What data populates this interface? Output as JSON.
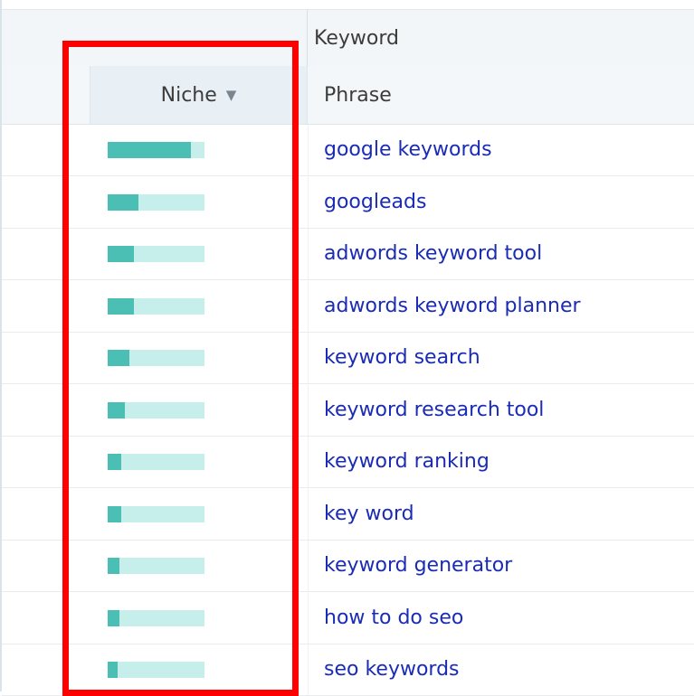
{
  "header": {
    "group_label": "Keyword",
    "niche_label": "Niche",
    "sort_arrow": "▼",
    "phrase_label": "Phrase"
  },
  "colors": {
    "bar_fill": "#4cbfb5",
    "bar_track": "#c6eeea",
    "link": "#1a2bb5",
    "highlight": "#ff0000"
  },
  "rows": [
    {
      "phrase": "google keywords",
      "niche": 0.86
    },
    {
      "phrase": "googleads",
      "niche": 0.32
    },
    {
      "phrase": "adwords keyword tool",
      "niche": 0.27
    },
    {
      "phrase": "adwords keyword planner",
      "niche": 0.27
    },
    {
      "phrase": "keyword search",
      "niche": 0.22
    },
    {
      "phrase": "keyword research tool",
      "niche": 0.18
    },
    {
      "phrase": "keyword ranking",
      "niche": 0.14
    },
    {
      "phrase": "key word",
      "niche": 0.14
    },
    {
      "phrase": "keyword generator",
      "niche": 0.12
    },
    {
      "phrase": "how to do seo",
      "niche": 0.12
    },
    {
      "phrase": "seo keywords",
      "niche": 0.1
    }
  ]
}
